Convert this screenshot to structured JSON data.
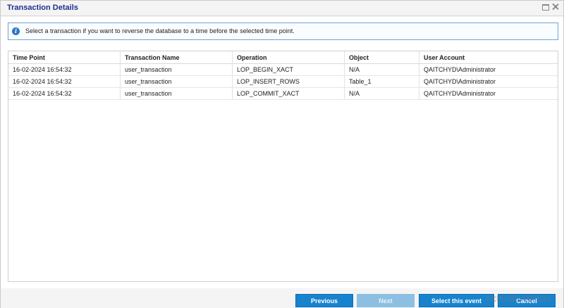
{
  "window": {
    "title": "Transaction Details"
  },
  "info": {
    "icon": "info-icon",
    "text": "Select a transaction if you want to reverse the database to a time before the selected time point."
  },
  "table": {
    "columns": [
      "Time Point",
      "Transaction Name",
      "Operation",
      "Object",
      "User Account"
    ],
    "rows": [
      [
        "16-02-2024 16:54:32",
        "user_transaction",
        "LOP_BEGIN_XACT",
        "N/A",
        "QAITCHYD\\Administrator"
      ],
      [
        "16-02-2024 16:54:32",
        "user_transaction",
        "LOP_INSERT_ROWS",
        "Table_1",
        "QAITCHYD\\Administrator"
      ],
      [
        "16-02-2024 16:54:32",
        "user_transaction",
        "LOP_COMMIT_XACT",
        "N/A",
        "QAITCHYD\\Administrator"
      ]
    ]
  },
  "buttons": {
    "previous": "Previous",
    "next": "Next",
    "select_event": "Select this event",
    "cancel": "Cancel"
  },
  "watermark": "Activate Windo",
  "colors": {
    "title": "#1f2f8c",
    "button": "#1783cf",
    "button_disabled": "#8dbfe2",
    "info_border": "#6da3d6"
  }
}
